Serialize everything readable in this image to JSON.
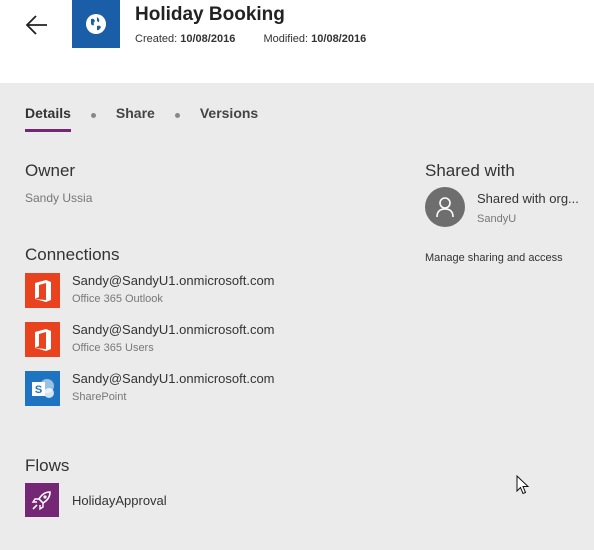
{
  "header": {
    "title": "Holiday Booking",
    "created_label": "Created:",
    "created_value": "10/08/2016",
    "modified_label": "Modified:",
    "modified_value": "10/08/2016",
    "app_icon": "globe-icon",
    "back_icon": "arrow-left-icon",
    "icon_color": "#1a5ea8"
  },
  "tabs": [
    {
      "label": "Details",
      "active": true
    },
    {
      "label": "Share",
      "active": false
    },
    {
      "label": "Versions",
      "active": false
    }
  ],
  "owner": {
    "heading": "Owner",
    "name": "Sandy Ussia"
  },
  "connections": {
    "heading": "Connections",
    "items": [
      {
        "account": "Sandy@SandyU1.onmicrosoft.com",
        "service": "Office 365 Outlook",
        "icon": "office-icon",
        "color": "#e8421f"
      },
      {
        "account": "Sandy@SandyU1.onmicrosoft.com",
        "service": "Office 365 Users",
        "icon": "office-icon",
        "color": "#e8421f"
      },
      {
        "account": "Sandy@SandyU1.onmicrosoft.com",
        "service": "SharePoint",
        "icon": "sharepoint-icon",
        "color": "#1f74c1"
      }
    ]
  },
  "flows": {
    "heading": "Flows",
    "items": [
      {
        "name": "HolidayApproval",
        "icon": "rocket-icon",
        "color": "#742774"
      }
    ]
  },
  "shared_with": {
    "heading": "Shared with",
    "entry_name": "Shared with org...",
    "entry_user": "SandyU",
    "manage_link": "Manage sharing and access",
    "avatar_icon": "person-icon"
  },
  "accent_color": "#742774"
}
